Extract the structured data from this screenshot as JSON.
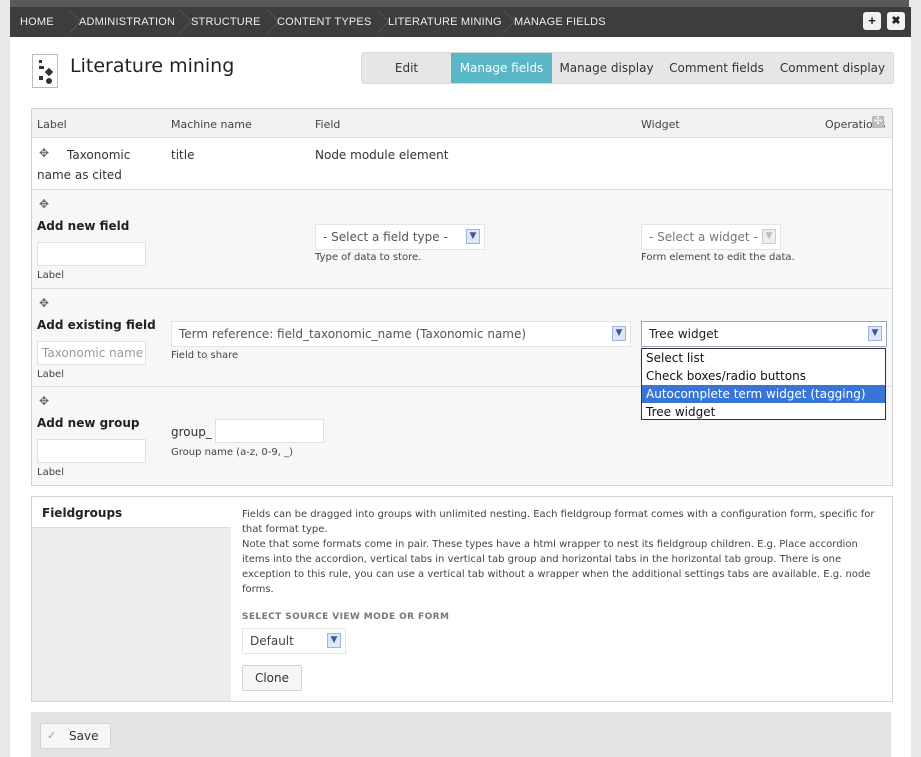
{
  "breadcrumb": [
    "HOME",
    "ADMINISTRATION",
    "STRUCTURE",
    "CONTENT TYPES",
    "LITERATURE MINING",
    "MANAGE FIELDS"
  ],
  "window_buttons": {
    "add": "+",
    "close": "✖"
  },
  "page": {
    "title": "Literature mining"
  },
  "tabs": [
    "Edit",
    "Manage fields",
    "Manage display",
    "Comment fields",
    "Comment display"
  ],
  "active_tab": "Manage fields",
  "table": {
    "headers": {
      "label": "Label",
      "machine_name": "Machine name",
      "field": "Field",
      "widget": "Widget",
      "operations": "Operations"
    },
    "rows": [
      {
        "label_line1": "Taxonomic",
        "label_line2": "name as cited",
        "machine_name": "title",
        "field": "Node module element"
      }
    ],
    "add_new_field": {
      "title": "Add new field",
      "label_caption": "Label",
      "field_type_select": "- Select a field type -",
      "field_type_help": "Type of data to store.",
      "widget_select": "- Select a widget -",
      "widget_help": "Form element to edit the data."
    },
    "add_existing_field": {
      "title": "Add existing field",
      "label_placeholder": "Taxonomic name",
      "label_caption": "Label",
      "field_select": "Term reference: field_taxonomic_name (Taxonomic name)",
      "field_help": "Field to share",
      "widget_select": "Tree widget",
      "widget_options": [
        "Select list",
        "Check boxes/radio buttons",
        "Autocomplete term widget (tagging)",
        "Tree widget"
      ],
      "highlighted_option": "Autocomplete term widget (tagging)"
    },
    "add_new_group": {
      "title": "Add new group",
      "label_caption": "Label",
      "group_prefix": "group_",
      "group_help": "Group name (a-z, 0-9, _)"
    }
  },
  "fieldgroups": {
    "title": "Fieldgroups",
    "description_1": "Fields can be dragged into groups with unlimited nesting. Each fieldgroup format comes with a configuration form, specific for that format type.",
    "description_2": "Note that some formats come in pair. These types have a html wrapper to nest its fieldgroup children. E.g. Place accordion items into the accordion, vertical tabs in vertical tab group and horizontal tabs in the horizontal tab group. There is one exception to this rule, you can use a vertical tab without a wrapper when the additional settings tabs are available. E.g. node forms.",
    "source_label": "SELECT SOURCE VIEW MODE OR FORM",
    "source_select": "Default",
    "clone_button": "Clone"
  },
  "save_button": "Save",
  "colors": {
    "active_tab": "#5bb7c6",
    "breadcrumb_bg": "#3d3d3d",
    "highlight": "#3875d7"
  }
}
